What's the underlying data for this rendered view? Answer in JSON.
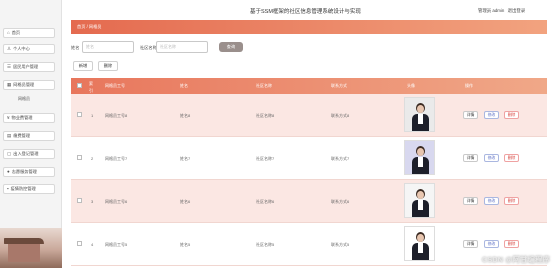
{
  "header": {
    "title": "基于SSM框架的社区信息管理系统设计与实现",
    "user_role": "管理员 admin",
    "logout": "退出登录"
  },
  "sidebar": {
    "items": [
      {
        "label": "首页",
        "icon": "home-icon"
      },
      {
        "label": "个人中心",
        "icon": "user-icon"
      },
      {
        "label": "居民用户管理",
        "icon": "users-icon"
      },
      {
        "label": "网格员管理",
        "icon": "grid-icon"
      },
      {
        "label": "物业费管理",
        "icon": "money-icon"
      },
      {
        "label": "缴费管理",
        "icon": "document-icon"
      },
      {
        "label": "出入登记管理",
        "icon": "door-icon"
      },
      {
        "label": "志愿服务管理",
        "icon": "location-icon"
      },
      {
        "label": "疫情防控管理",
        "icon": "apps-icon"
      }
    ],
    "subitem": "网格员"
  },
  "breadcrumb": {
    "home": "首页",
    "current": "网格员"
  },
  "search": {
    "label_name": "姓名",
    "placeholder_name": "姓名",
    "label_area": "社区名称",
    "placeholder_area": "社区名称",
    "button": "查询"
  },
  "actions": {
    "add": "新增",
    "delete": "删除"
  },
  "table": {
    "headers": [
      "索引",
      "网格员工号",
      "姓名",
      "社区名称",
      "联系方式",
      "头像",
      "操作"
    ],
    "rows": [
      {
        "index": "1",
        "no": "网格员工号8",
        "name": "姓名8",
        "area": "社区名称8",
        "contact": "联系方式8"
      },
      {
        "index": "2",
        "no": "网格员工号7",
        "name": "姓名7",
        "area": "社区名称7",
        "contact": "联系方式7"
      },
      {
        "index": "3",
        "no": "网格员工号6",
        "name": "姓名6",
        "area": "社区名称6",
        "contact": "联系方式6"
      },
      {
        "index": "4",
        "no": "网格员工号5",
        "name": "姓名5",
        "area": "社区名称5",
        "contact": "联系方式5"
      }
    ],
    "op_detail": "详情",
    "op_edit": "修改",
    "op_delete": "删除"
  },
  "watermark": "CSDN @阿甘编程序",
  "colors": {
    "accent": "#e46a4f",
    "row_tint": "#fbe7e3",
    "edit": "#5c6fc5",
    "delete": "#d6453f"
  }
}
